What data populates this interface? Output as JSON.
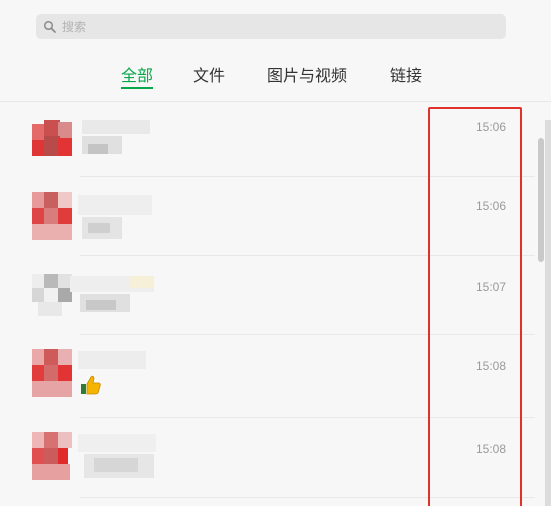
{
  "search": {
    "placeholder": "搜索"
  },
  "tabs": [
    {
      "label": "全部",
      "active": true
    },
    {
      "label": "文件",
      "active": false
    },
    {
      "label": "图片与视频",
      "active": false
    },
    {
      "label": "链接",
      "active": false
    }
  ],
  "messages": [
    {
      "time": "15:06"
    },
    {
      "time": "15:06"
    },
    {
      "time": "15:07"
    },
    {
      "time": "15:08"
    },
    {
      "time": "15:08"
    }
  ],
  "colors": {
    "accent_green": "#07a74a",
    "highlight_red": "#e0322b",
    "time_gray": "#9a9a9a"
  },
  "icons": {
    "search": "search-icon",
    "emoji": "thumbs-up-icon"
  }
}
